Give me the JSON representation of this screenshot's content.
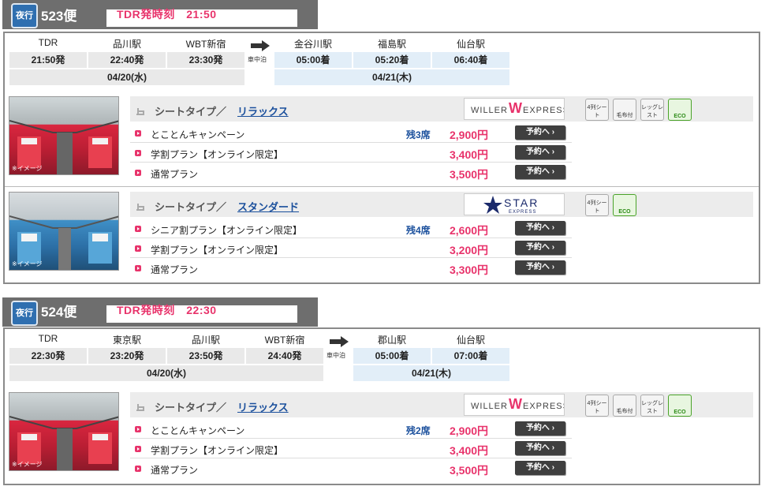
{
  "flights": [
    {
      "badge": "夜行",
      "number": "523便",
      "tdr_departure": "TDR発時刻　21:50",
      "departures": [
        {
          "station": "TDR",
          "time": "21:50発"
        },
        {
          "station": "品川駅",
          "time": "22:40発"
        },
        {
          "station": "WBT新宿",
          "time": "23:30発"
        }
      ],
      "arrivals": [
        {
          "station": "金谷川駅",
          "time": "05:00着"
        },
        {
          "station": "福島駅",
          "time": "05:20着"
        },
        {
          "station": "仙台駅",
          "time": "06:40着"
        }
      ],
      "dep_date": "04/20(水)",
      "arr_date": "04/21(木)",
      "overnight_label": "車中泊",
      "seat_groups": [
        {
          "photo_label": "※イメージ",
          "seat_type_label": "シートタイプ／",
          "seat_type": "リラックス",
          "logo": "WILLER EXPRESS",
          "features": [
            "4列シート",
            "毛布付",
            "レッグレスト",
            "ECO"
          ],
          "plans": [
            {
              "name": "とことんキャンペーン",
              "remaining": "残3席",
              "price": "2,900円",
              "button": "予約へ ›"
            },
            {
              "name": "学割プラン【オンライン限定】",
              "remaining": "",
              "price": "3,400円",
              "button": "予約へ ›"
            },
            {
              "name": "通常プラン",
              "remaining": "",
              "price": "3,500円",
              "button": "予約へ ›"
            }
          ]
        },
        {
          "photo_label": "※イメージ",
          "seat_type_label": "シートタイプ／",
          "seat_type": "スタンダード",
          "logo": "STAR EXPRESS",
          "features": [
            "4列シート",
            "ECO"
          ],
          "plans": [
            {
              "name": "シニア割プラン【オンライン限定】",
              "remaining": "残4席",
              "price": "2,600円",
              "button": "予約へ ›"
            },
            {
              "name": "学割プラン【オンライン限定】",
              "remaining": "",
              "price": "3,200円",
              "button": "予約へ ›"
            },
            {
              "name": "通常プラン",
              "remaining": "",
              "price": "3,300円",
              "button": "予約へ ›"
            }
          ]
        }
      ]
    },
    {
      "badge": "夜行",
      "number": "524便",
      "tdr_departure": "TDR発時刻　22:30",
      "departures": [
        {
          "station": "TDR",
          "time": "22:30発"
        },
        {
          "station": "東京駅",
          "time": "23:20発"
        },
        {
          "station": "品川駅",
          "time": "23:50発"
        },
        {
          "station": "WBT新宿",
          "time": "24:40発"
        }
      ],
      "arrivals": [
        {
          "station": "郡山駅",
          "time": "05:00着"
        },
        {
          "station": "仙台駅",
          "time": "07:00着"
        }
      ],
      "dep_date": "04/20(水)",
      "arr_date": "04/21(木)",
      "overnight_label": "車中泊",
      "seat_groups": [
        {
          "photo_label": "※イメージ",
          "seat_type_label": "シートタイプ／",
          "seat_type": "リラックス",
          "logo": "WILLER EXPRESS",
          "features": [
            "4列シート",
            "毛布付",
            "レッグレスト",
            "ECO"
          ],
          "plans": [
            {
              "name": "とことんキャンペーン",
              "remaining": "残2席",
              "price": "2,900円",
              "button": "予約へ ›"
            },
            {
              "name": "学割プラン【オンライン限定】",
              "remaining": "",
              "price": "3,400円",
              "button": "予約へ ›"
            },
            {
              "name": "通常プラン",
              "remaining": "",
              "price": "3,500円",
              "button": "予約へ ›"
            }
          ]
        }
      ]
    }
  ],
  "colors": {
    "accent_pink": "#e8336b",
    "link_blue": "#1a4f9c",
    "tab_gray": "#6e6e6e"
  }
}
